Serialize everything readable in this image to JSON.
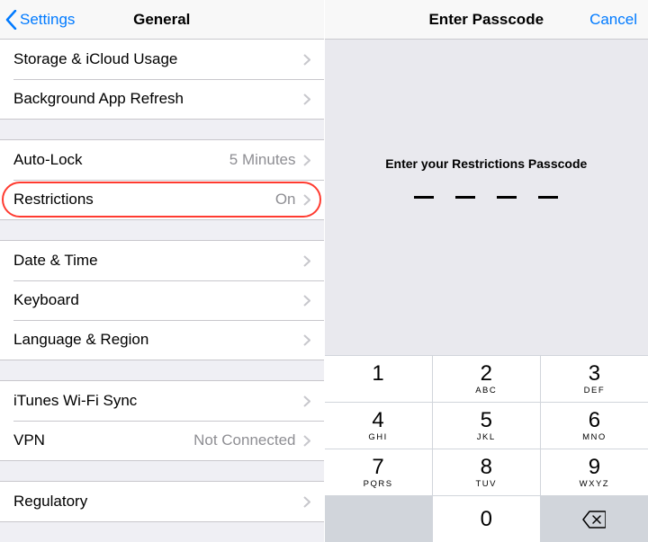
{
  "left": {
    "nav": {
      "back": "Settings",
      "title": "General"
    },
    "group1": [
      {
        "label": "Storage & iCloud Usage",
        "detail": ""
      },
      {
        "label": "Background App Refresh",
        "detail": ""
      }
    ],
    "group2": [
      {
        "label": "Auto-Lock",
        "detail": "5 Minutes"
      },
      {
        "label": "Restrictions",
        "detail": "On"
      }
    ],
    "group3": [
      {
        "label": "Date & Time",
        "detail": ""
      },
      {
        "label": "Keyboard",
        "detail": ""
      },
      {
        "label": "Language & Region",
        "detail": ""
      }
    ],
    "group4": [
      {
        "label": "iTunes Wi-Fi Sync",
        "detail": ""
      },
      {
        "label": "VPN",
        "detail": "Not Connected"
      }
    ],
    "group5": [
      {
        "label": "Regulatory",
        "detail": ""
      }
    ]
  },
  "right": {
    "nav": {
      "title": "Enter Passcode",
      "cancel": "Cancel"
    },
    "prompt": "Enter your Restrictions Passcode",
    "keys": [
      {
        "digit": "1",
        "letters": " "
      },
      {
        "digit": "2",
        "letters": "ABC"
      },
      {
        "digit": "3",
        "letters": "DEF"
      },
      {
        "digit": "4",
        "letters": "GHI"
      },
      {
        "digit": "5",
        "letters": "JKL"
      },
      {
        "digit": "6",
        "letters": "MNO"
      },
      {
        "digit": "7",
        "letters": "PQRS"
      },
      {
        "digit": "8",
        "letters": "TUV"
      },
      {
        "digit": "9",
        "letters": "WXYZ"
      },
      {
        "digit": "0",
        "letters": ""
      }
    ]
  }
}
